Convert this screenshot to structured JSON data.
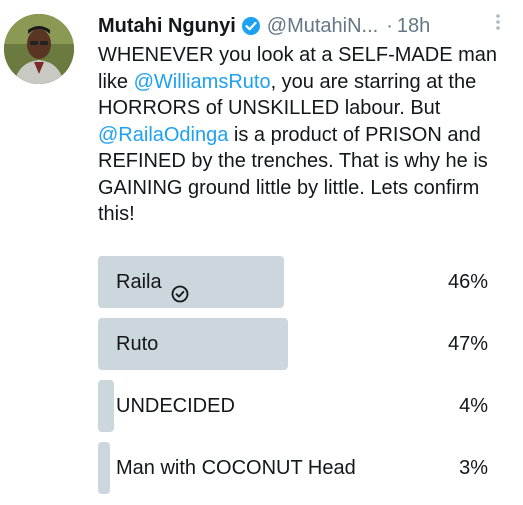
{
  "tweet": {
    "author_name": "Mutahi Ngunyi",
    "handle": "@MutahiN...",
    "separator": "·",
    "time": "18h",
    "more_icon": "more-vertical-icon",
    "text_1": "WHENEVER you look at a SELF-MADE man like ",
    "mention_1": "@WilliamsRuto",
    "text_2": ", you are starring at the HORRORS of UNSKILLED labour. But ",
    "mention_2": "@RailaOdinga",
    "text_3": " is a product of PRISON and REFINED by the trenches. That is why he is GAINING ground little by little. Lets confirm this!"
  },
  "poll": {
    "options": [
      {
        "label": "Raila",
        "percent_text": "46%",
        "fraction": 0.46,
        "selected": true
      },
      {
        "label": "Ruto",
        "percent_text": "47%",
        "fraction": 0.47,
        "selected": false
      },
      {
        "label": "UNDECIDED",
        "percent_text": "4%",
        "fraction": 0.04,
        "selected": false
      },
      {
        "label": "Man with COCONUT Head",
        "percent_text": "3%",
        "fraction": 0.03,
        "selected": false
      }
    ]
  },
  "colors": {
    "accent": "#1da1f2",
    "bar": "#ccd6dd",
    "muted": "#657786"
  }
}
